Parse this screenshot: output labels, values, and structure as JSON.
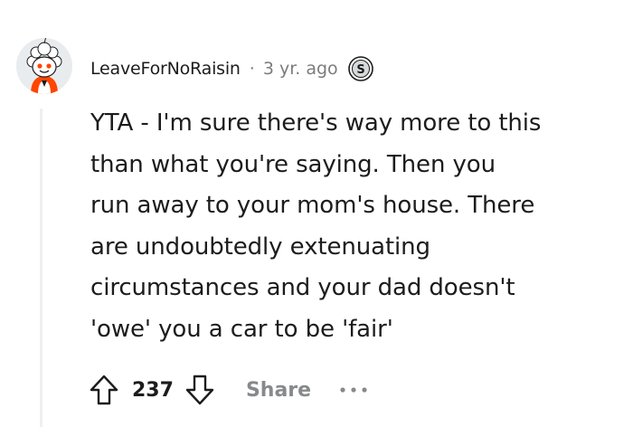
{
  "comment": {
    "author": "LeaveForNoRaisin",
    "separator": "·",
    "timestamp": "3 yr. ago",
    "body_lines": [
      "YTA - I'm sure there's way more to this",
      "than what you're saying. Then you",
      "run away to your mom's house. There",
      "are undoubtedly extenuating",
      "circumstances and your dad doesn't",
      "'owe' you a car to be 'fair'"
    ]
  },
  "actions": {
    "score": "237",
    "share_label": "Share"
  },
  "icons": {
    "avatar": "snoo-avatar-icon",
    "badge": "snoo-s-badge-icon",
    "upvote": "arrow-up-icon",
    "downvote": "arrow-down-icon",
    "more": "more-horizontal-icon"
  },
  "colors": {
    "text": "#1c1c1c",
    "meta": "#7c7c7c",
    "share": "#878a8c",
    "thread_line": "#edeff1",
    "avatar_accent": "#ff4500"
  }
}
